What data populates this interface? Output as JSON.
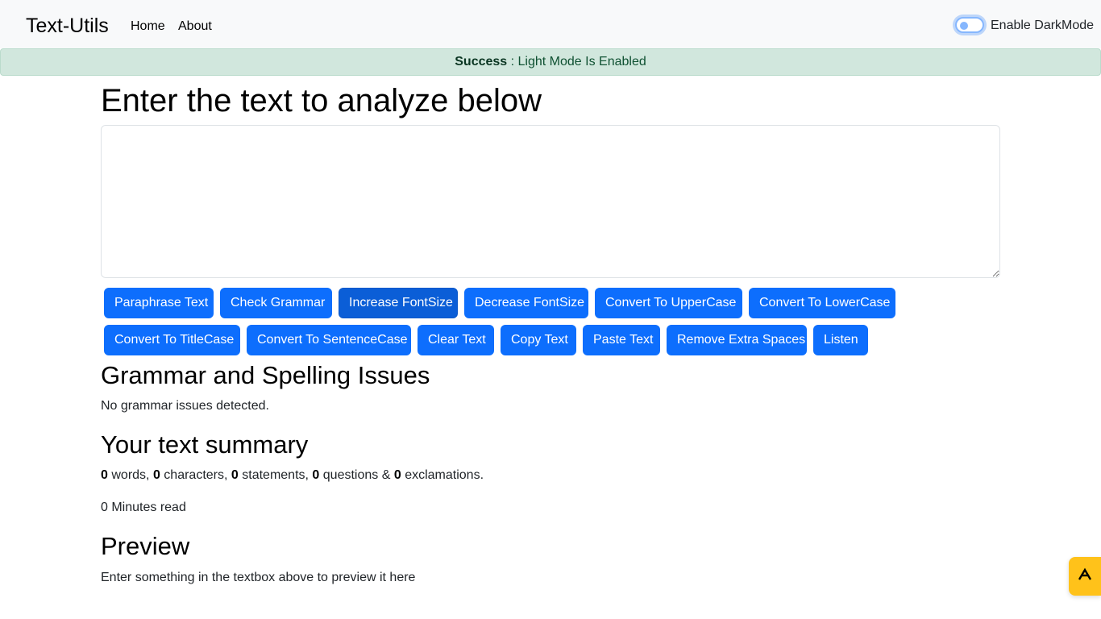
{
  "navbar": {
    "brand": "Text-Utils",
    "links": [
      "Home",
      "About"
    ],
    "dark_mode_label": "Enable DarkMode"
  },
  "alert": {
    "title": "Success",
    "message": ": Light Mode Is Enabled",
    "color": "#d1e7dd"
  },
  "main": {
    "heading": "Enter the text to analyze below",
    "textarea_value": ""
  },
  "buttons": [
    "Paraphrase Text",
    "Check Grammar",
    "Increase FontSize",
    "Decrease FontSize",
    "Convert To UpperCase",
    "Convert To LowerCase",
    "Convert To TitleCase",
    "Convert To SentenceCase",
    "Clear Text",
    "Copy Text",
    "Paste Text",
    "Remove Extra Spaces",
    "Listen"
  ],
  "grammar": {
    "heading": "Grammar and Spelling Issues",
    "message": "No grammar issues detected."
  },
  "summary": {
    "heading": "Your text summary",
    "words": "0",
    "words_label": "words,",
    "characters": "0",
    "characters_label": "characters,",
    "statements": "0",
    "statements_label": "statements,",
    "questions": "0",
    "questions_label": "questions &",
    "exclamations": "0",
    "exclamations_label": "exclamations.",
    "read_time": "0 Minutes read"
  },
  "preview": {
    "heading": "Preview",
    "text": "Enter something in the textbox above to preview it here"
  },
  "colors": {
    "primary": "#0d6efd",
    "navbar_bg": "#f8f9fa",
    "fab_bg": "#ffc21a"
  },
  "fab_icon": "extension-logo-icon"
}
